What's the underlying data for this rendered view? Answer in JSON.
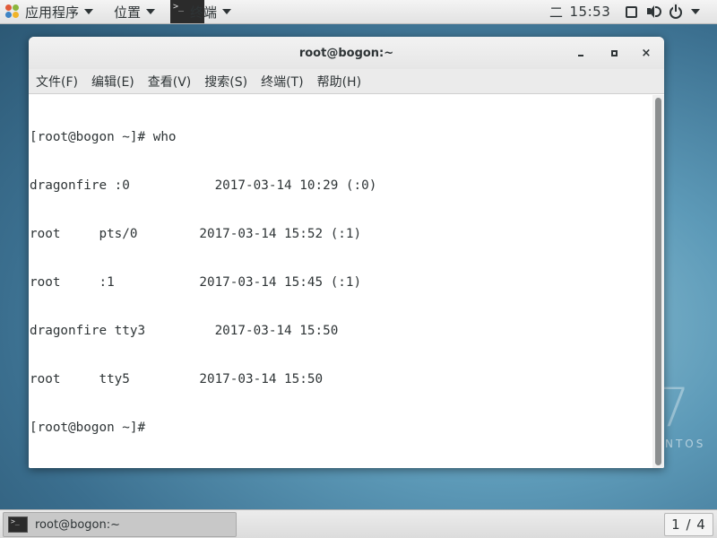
{
  "top_panel": {
    "apps_label": "应用程序",
    "places_label": "位置",
    "terminal_menu_label": "终端",
    "input_method": "二",
    "clock": "15:53"
  },
  "window": {
    "title": "root@bogon:~",
    "close_glyph": "×"
  },
  "menu": {
    "items": [
      "文件(F)",
      "编辑(E)",
      "查看(V)",
      "搜索(S)",
      "终端(T)",
      "帮助(H)"
    ]
  },
  "terminal": {
    "lines": [
      "[root@bogon ~]# who",
      "dragonfire :0           2017-03-14 10:29 (:0)",
      "root     pts/0        2017-03-14 15:52 (:1)",
      "root     :1           2017-03-14 15:45 (:1)",
      "dragonfire tty3         2017-03-14 15:50",
      "root     tty5         2017-03-14 15:50",
      "[root@bogon ~]# "
    ]
  },
  "watermark": {
    "number": "7",
    "text": "NTOS"
  },
  "bottom_panel": {
    "task_label": "root@bogon:~",
    "workspace": "1 / 4"
  },
  "icons": {
    "apps": "apps-icon",
    "terminal": "terminal-icon",
    "screen": "screen-icon",
    "volume": "volume-icon",
    "power": "power-icon"
  },
  "colors": {
    "panel_bg": "#e9e9e9",
    "terminal_text": "#2e3436",
    "desktop_bg": "#4f8bab"
  }
}
